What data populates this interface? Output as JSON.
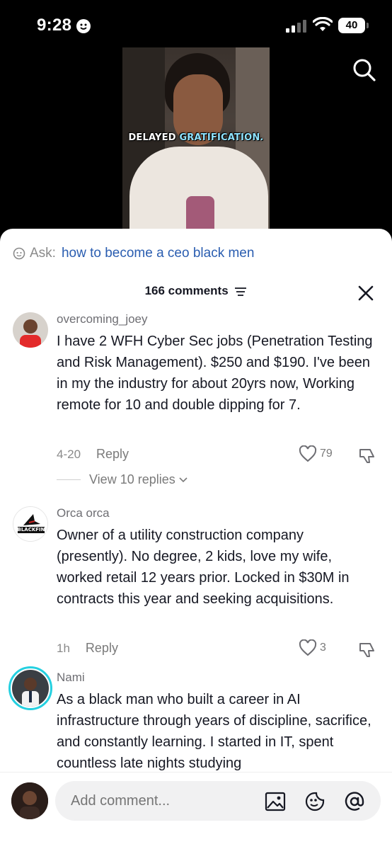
{
  "status": {
    "time": "9:28",
    "battery": "40"
  },
  "video": {
    "caption_part1": "DELAYED",
    "caption_part2": "GRATIFICATION."
  },
  "ask": {
    "label": "Ask:",
    "query": "how to become a ceo black men"
  },
  "comments_header": {
    "title": "166 comments"
  },
  "comments": [
    {
      "username": "overcoming_joey",
      "text": "I have 2 WFH Cyber Sec jobs (Penetration Testing and Risk Management). $250 and $190. I've been in my the industry for about 20yrs now, Working remote for 10 and double dipping for 7.",
      "date": "4-20",
      "reply_label": "Reply",
      "likes": "79",
      "view_replies": "View 10 replies"
    },
    {
      "username": "Orca orca",
      "avatar_text": "BLACKFIN",
      "text": "Owner of a utility construction company (presently). No degree, 2 kids, love my wife, worked retail 12 years prior. Locked in $30M in contracts this year and seeking acquisitions.",
      "date": "1h",
      "reply_label": "Reply",
      "likes": "3"
    },
    {
      "username": "Nami",
      "text": "As a black man who built a career in AI infrastructure through years of discipline, sacrifice, and constantly learning. I started in IT, spent countless late nights studying"
    }
  ],
  "input": {
    "placeholder": "Add comment..."
  },
  "colors": {
    "link": "#2a5db0",
    "text": "#161823",
    "muted": "#8a8a8a"
  }
}
